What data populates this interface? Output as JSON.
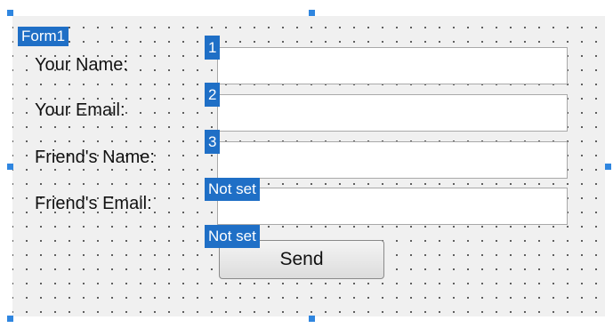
{
  "form": {
    "title_tag": "Form1",
    "fields": [
      {
        "label": "Your Name:",
        "tab_tag": "1",
        "value": ""
      },
      {
        "label": "Your Email:",
        "tab_tag": "2",
        "value": ""
      },
      {
        "label": "Friend's Name:",
        "tab_tag": "3",
        "value": ""
      },
      {
        "label": "Friend's Email:",
        "tab_tag": "Not set",
        "value": ""
      }
    ],
    "send_button": {
      "label": "Send",
      "tab_tag": "Not set"
    }
  }
}
